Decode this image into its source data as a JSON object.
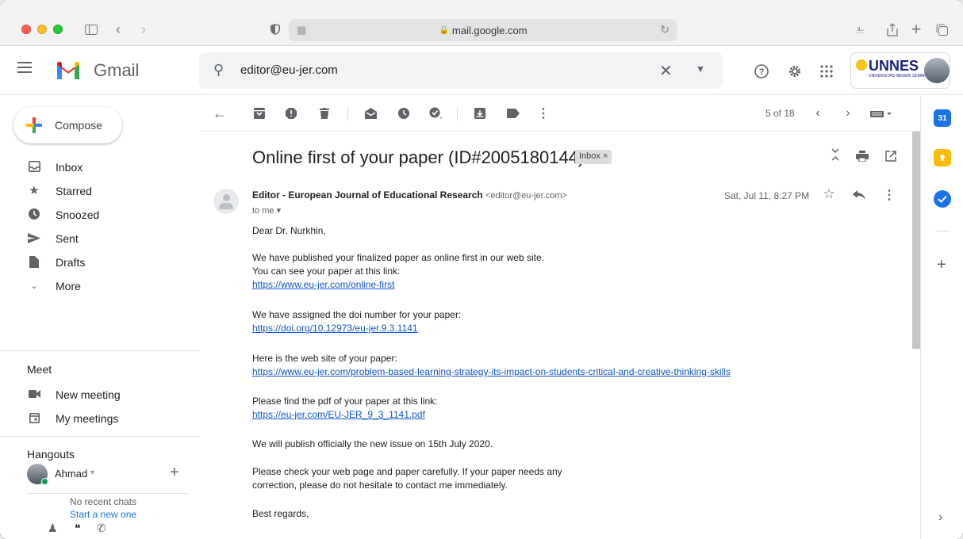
{
  "browser": {
    "url": "mail.google.com",
    "back_icon": "chevron-left",
    "forward_icon": "chevron-right"
  },
  "gmail": {
    "app_name": "Gmail",
    "search_query": "editor@eu-jer.com",
    "brand": {
      "text": "UNNES",
      "subtitle": "UNIVERSITAS NEGERI SEMARANG"
    }
  },
  "sidebar": {
    "compose_label": "Compose",
    "items": [
      {
        "label": "Inbox",
        "icon": "inbox-icon"
      },
      {
        "label": "Starred",
        "icon": "star-icon"
      },
      {
        "label": "Snoozed",
        "icon": "clock-icon"
      },
      {
        "label": "Sent",
        "icon": "send-icon"
      },
      {
        "label": "Drafts",
        "icon": "file-icon"
      },
      {
        "label": "More",
        "icon": "chevron-down-icon"
      }
    ],
    "meet": {
      "title": "Meet",
      "items": [
        {
          "label": "New meeting",
          "icon": "video-icon"
        },
        {
          "label": "My meetings",
          "icon": "calendar-icon"
        }
      ]
    },
    "hangouts": {
      "title": "Hangouts",
      "user": "Ahmad",
      "no_chats": "No recent chats",
      "start_new": "Start a new one"
    }
  },
  "toolbar": {
    "pager": "5 of 18"
  },
  "email": {
    "subject": "Online first of your paper (ID#2005180144)",
    "tag": "Inbox ×",
    "sender_name": "Editor - European Journal of Educational Research",
    "sender_email": "<editor@eu-jer.com>",
    "to": "to me ▾",
    "date": "Sat, Jul 11, 8:27 PM",
    "body": {
      "greeting": "Dear Dr. Nurkhin,",
      "p1a": "We have published your finalized paper as online first in our web site.",
      "p1b": "You can see your paper at this link:",
      "link1": "https://www.eu-jer.com/online-first",
      "p2": "We have assigned the doi number for your paper:",
      "link2": "https://doi.org/10.12973/eu-jer.9.3.1141",
      "p3": "Here is the web site of your paper:",
      "link3": "https://www.eu-jer.com/problem-based-learning-strategy-its-impact-on-students-critical-and-creative-thinking-skills",
      "p4": "Please find the pdf of your paper at this link:",
      "link4": "https://eu-jer.com/EU-JER_9_3_1141.pdf",
      "p5": "We will publish officially the new issue on 15th July 2020.",
      "p6a": "Please check your web page and paper carefully. If your paper needs any",
      "p6b": "correction, please do not hesitate to contact me immediately.",
      "closing": "Best regards,"
    }
  },
  "colors": {
    "link": "#1155cc",
    "calendar": "#1a73e8",
    "keep": "#fbbc04",
    "tasks": "#1a73e8"
  }
}
